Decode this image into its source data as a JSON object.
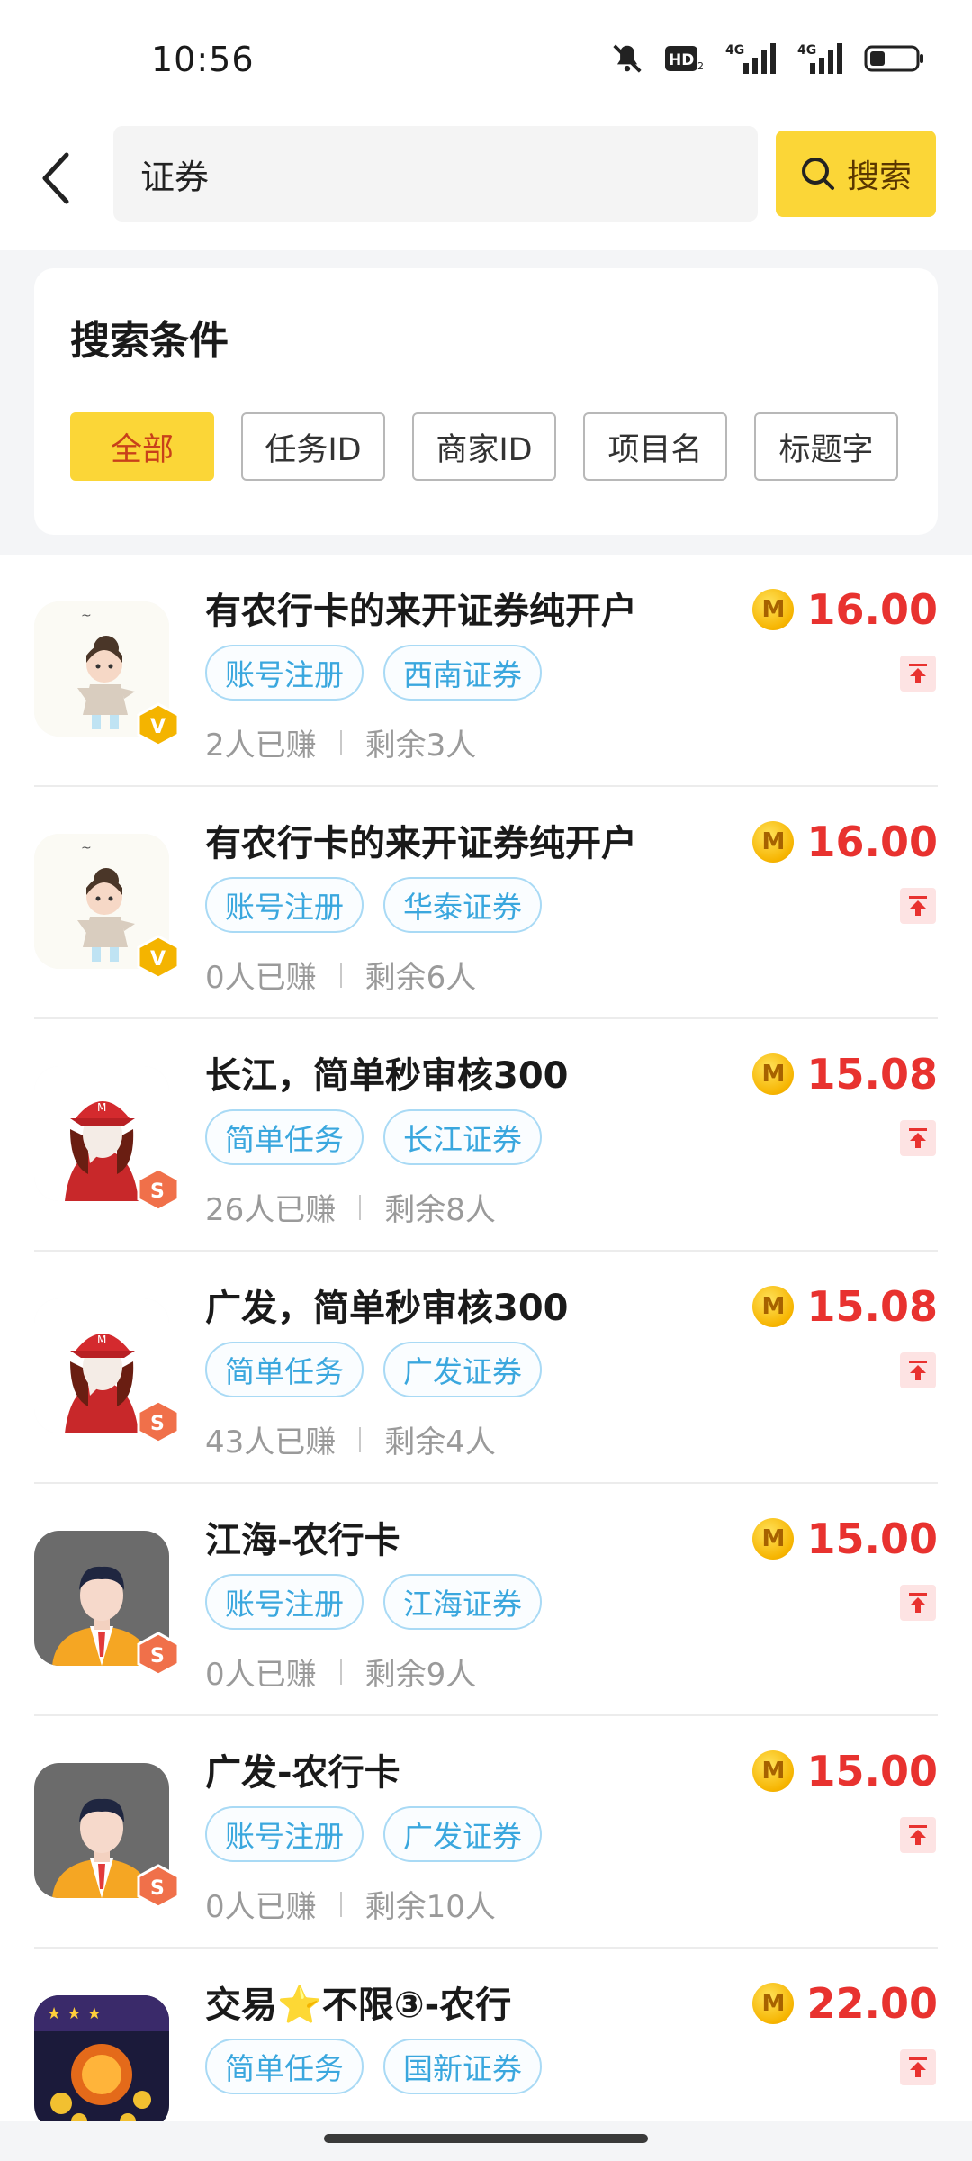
{
  "status_bar": {
    "time": "10:56",
    "network_label_1": "4G",
    "network_label_2": "4G",
    "hd_label": "HD"
  },
  "header": {
    "search_value": "证券",
    "search_button_label": "搜索"
  },
  "filter": {
    "title": "搜索条件",
    "chips": [
      "全部",
      "任务ID",
      "商家ID",
      "项目名",
      "标题字"
    ],
    "active_index": 0
  },
  "coin_letter": "M",
  "tasks": [
    {
      "title": "有农行卡的来开证券纯开户",
      "tags": [
        "账号注册",
        "西南证券"
      ],
      "earned": "2人已赚",
      "remaining": "剩余3人",
      "price": "16.00",
      "avatar": "cartoon-girl-avatar",
      "badge": "V"
    },
    {
      "title": "有农行卡的来开证券纯开户",
      "tags": [
        "账号注册",
        "华泰证券"
      ],
      "earned": "0人已赚",
      "remaining": "剩余6人",
      "price": "16.00",
      "avatar": "cartoon-girl-avatar",
      "badge": "V"
    },
    {
      "title": "长江，简单秒审核300",
      "tags": [
        "简单任务",
        "长江证券"
      ],
      "earned": "26人已赚",
      "remaining": "剩余8人",
      "price": "15.08",
      "avatar": "red-cap-girl-avatar",
      "badge": "S"
    },
    {
      "title": "广发，简单秒审核300",
      "tags": [
        "简单任务",
        "广发证券"
      ],
      "earned": "43人已赚",
      "remaining": "剩余4人",
      "price": "15.08",
      "avatar": "red-cap-girl-avatar",
      "badge": "S"
    },
    {
      "title": "江海-农行卡",
      "tags": [
        "账号注册",
        "江海证券"
      ],
      "earned": "0人已赚",
      "remaining": "剩余9人",
      "price": "15.00",
      "avatar": "businessman-avatar",
      "badge": "S"
    },
    {
      "title": "广发-农行卡",
      "tags": [
        "账号注册",
        "广发证券"
      ],
      "earned": "0人已赚",
      "remaining": "剩余10人",
      "price": "15.00",
      "avatar": "businessman-avatar",
      "badge": "S"
    },
    {
      "title": "交易⭐不限③-农行",
      "tags": [
        "简单任务",
        "国新证券"
      ],
      "earned": "",
      "remaining": "",
      "price": "22.00",
      "avatar": "game-poster-avatar",
      "badge": ""
    }
  ]
}
